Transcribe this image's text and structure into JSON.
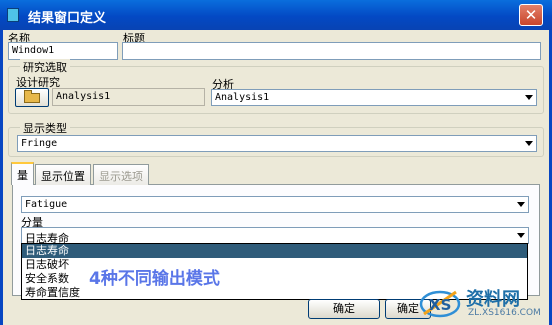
{
  "window": {
    "title": "结果窗口定义",
    "close_glyph": "✕"
  },
  "name_field": {
    "label": "名称",
    "value": "Window1"
  },
  "title_field": {
    "label": "标题",
    "value": ""
  },
  "study_select": {
    "group_label": "研究选取",
    "design_study_label": "设计研究",
    "design_study_value": "Analysis1",
    "analysis_label": "分析",
    "analysis_value": "Analysis1"
  },
  "display_type": {
    "group_label": "显示类型",
    "value": "Fringe"
  },
  "tabs": [
    {
      "label": "量",
      "state": "active"
    },
    {
      "label": "显示位置",
      "state": "normal"
    },
    {
      "label": "显示选项",
      "state": "disabled"
    }
  ],
  "quantity": {
    "type_value": "Fatigue",
    "component_label": "分量",
    "component_value": "日志寿命",
    "options": [
      "日志寿命",
      "日志破坏",
      "安全系数",
      "寿命置信度"
    ],
    "selected_index": 0
  },
  "buttons": {
    "ok": "确定",
    "ok2": "确定"
  },
  "annotation": "4种不同输出模式",
  "watermark": {
    "text": "资料网",
    "url": "ZL.XS1616.COM",
    "logo_letters": "XS"
  },
  "colors": {
    "titlebar": "#0a5bd6",
    "dialog_bg": "#ece9d8",
    "selection": "#2f5c7a",
    "annotation": "#5a76e8"
  }
}
